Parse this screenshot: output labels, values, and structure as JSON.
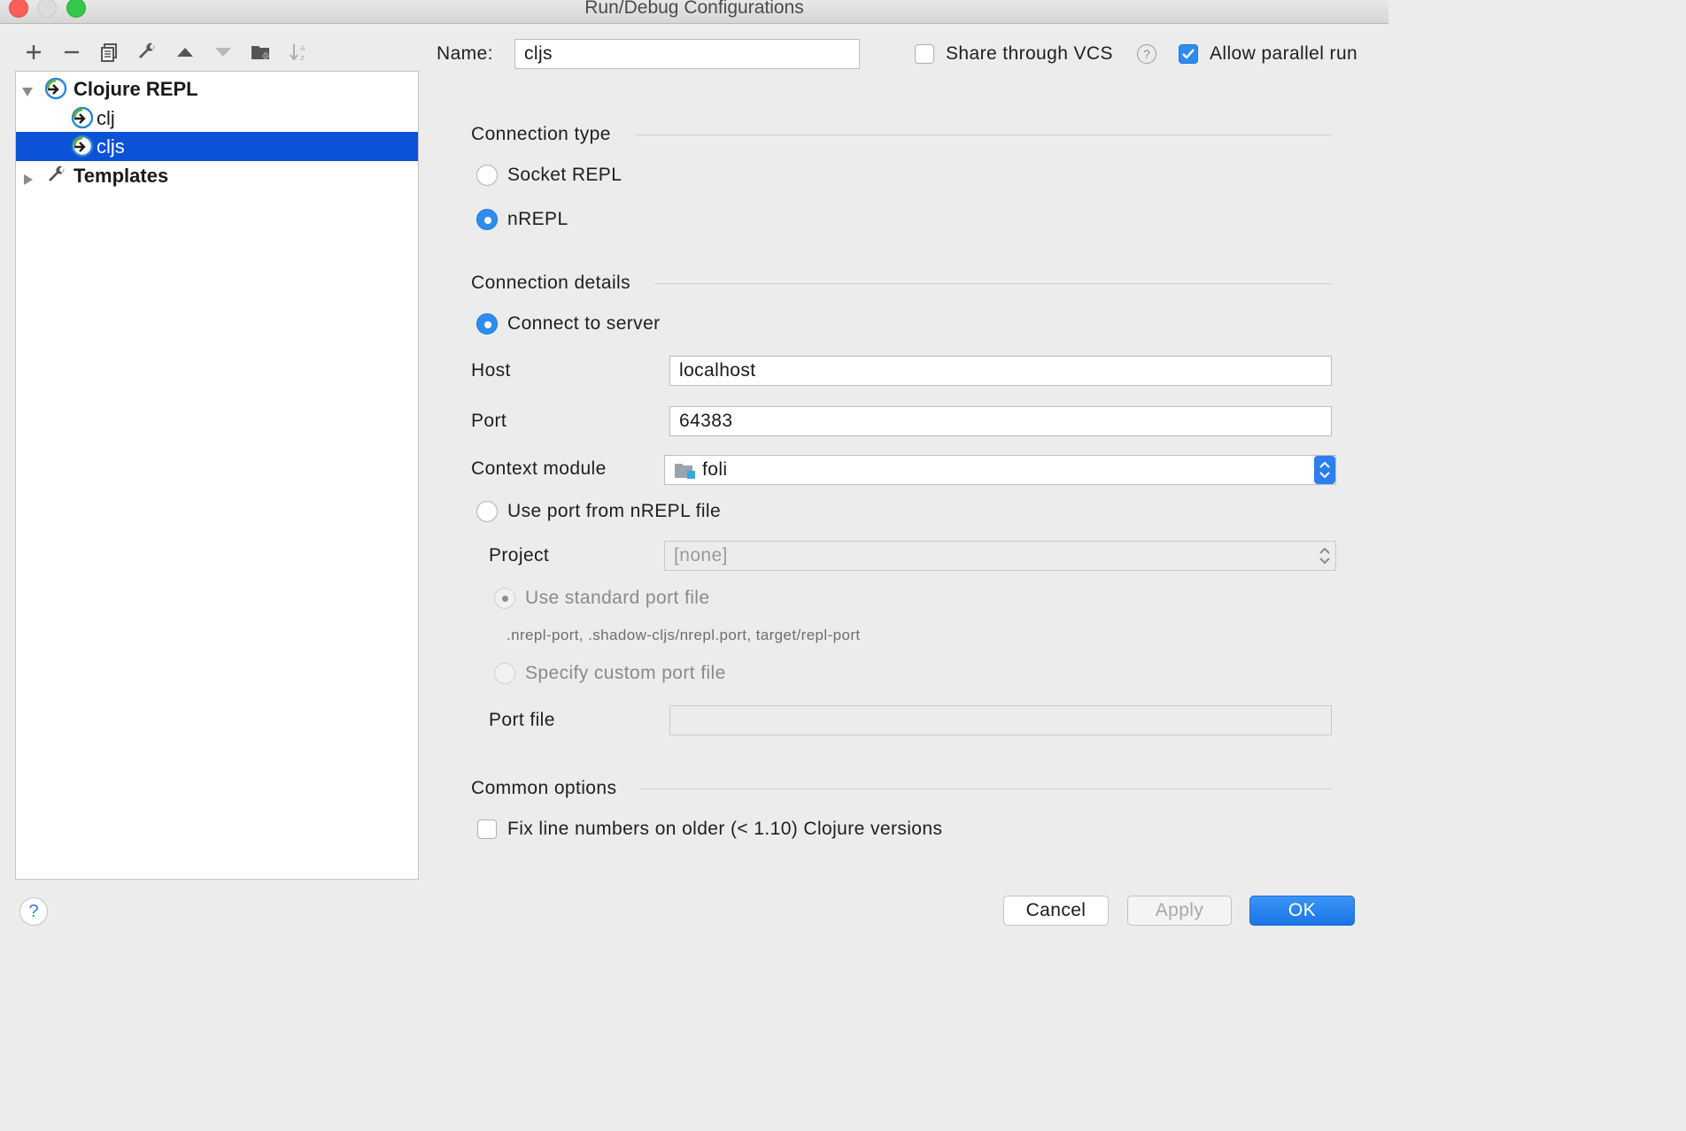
{
  "window": {
    "title": "Run/Debug Configurations"
  },
  "toolbar": {
    "icons": [
      "add-icon",
      "remove-icon",
      "copy-icon",
      "wrench-icon",
      "move-up-icon",
      "move-down-icon",
      "folder-add-icon",
      "sort-icon"
    ]
  },
  "tree": {
    "items": [
      {
        "label": "Clojure REPL",
        "expanded": true,
        "bold": true
      },
      {
        "label": "clj"
      },
      {
        "label": "cljs",
        "selected": true
      },
      {
        "label": "Templates",
        "expanded": false,
        "bold": true
      }
    ]
  },
  "header": {
    "name_label": "Name:",
    "name_value": "cljs",
    "share_vcs": {
      "label": "Share through VCS",
      "checked": false
    },
    "allow_parallel": {
      "label": "Allow parallel run",
      "checked": true
    }
  },
  "connection_type": {
    "section_label": "Connection type",
    "options": [
      {
        "label": "Socket REPL",
        "selected": false
      },
      {
        "label": "nREPL",
        "selected": true
      }
    ]
  },
  "connection_details": {
    "section_label": "Connection details",
    "connect_to_server": {
      "label": "Connect to server",
      "selected": true
    },
    "host_label": "Host",
    "host_value": "localhost",
    "port_label": "Port",
    "port_value": "64383",
    "context_module_label": "Context module",
    "context_module_value": "foli",
    "use_port_file": {
      "label": "Use port from nREPL file",
      "selected": false
    },
    "project_label": "Project",
    "project_value": "[none]",
    "standard_port_file": {
      "label": "Use standard port file",
      "selected": true
    },
    "standard_port_hint": ".nrepl-port, .shadow-cljs/nrepl.port, target/repl-port",
    "custom_port_file": {
      "label": "Specify custom port file",
      "selected": false
    },
    "port_file_label": "Port file",
    "port_file_value": ""
  },
  "common_options": {
    "section_label": "Common options",
    "fix_line_numbers": {
      "label": "Fix line numbers on older (< 1.10) Clojure versions",
      "checked": false
    }
  },
  "footer": {
    "help_label": "?",
    "cancel_label": "Cancel",
    "apply_label": "Apply",
    "ok_label": "OK"
  },
  "colors": {
    "selection": "#0b52d6",
    "accent": "#2d8cf0"
  }
}
